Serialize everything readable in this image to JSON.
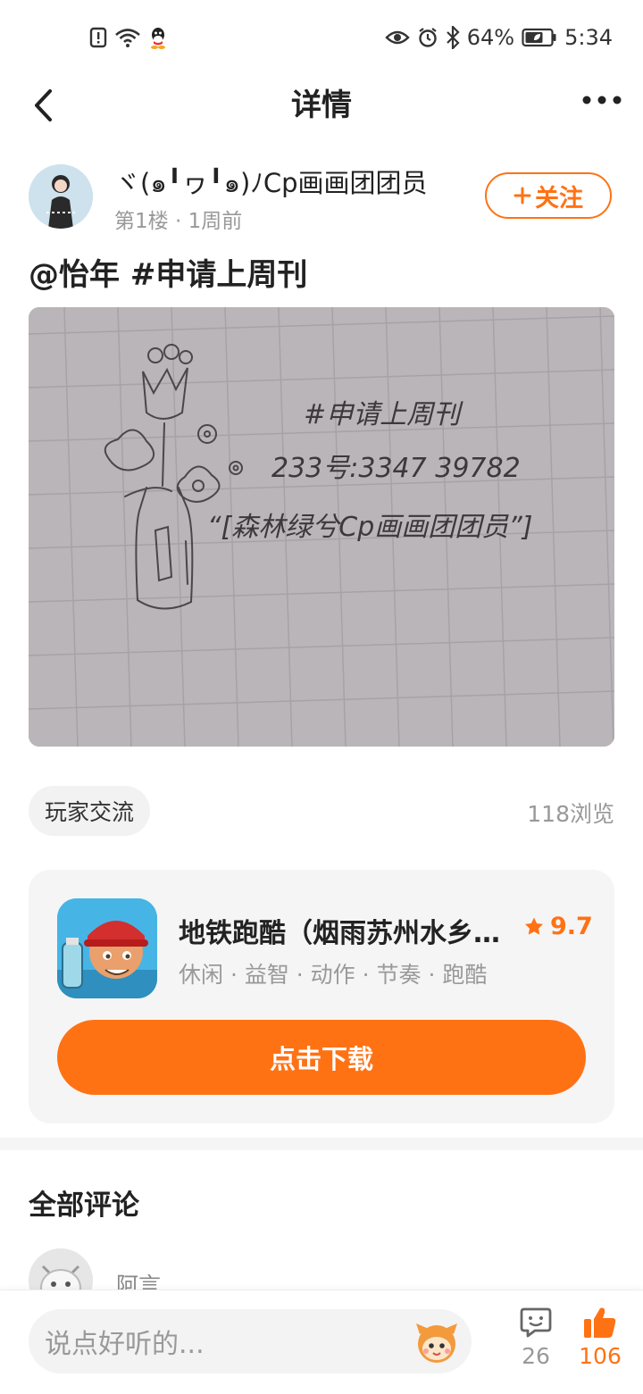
{
  "status_bar": {
    "battery": "64%",
    "time": "5:34",
    "icons": [
      "notification-icon",
      "wifi-icon",
      "qq-icon",
      "eye-icon",
      "alarm-icon",
      "bluetooth-icon",
      "battery-icon"
    ]
  },
  "header": {
    "title": "详情"
  },
  "author": {
    "name": "ヾ(๑╹ヮ╹๑)ﾉCp画画团团员",
    "meta": "第1楼 · 1周前",
    "follow_label": "关注"
  },
  "post": {
    "title": "@怡年   #申请上周刊",
    "tag": "玩家交流",
    "views": "118浏览"
  },
  "game_card": {
    "name": "地铁跑酷（烟雨苏州水乡…",
    "rating": "9.7",
    "tags": "休闲 · 益智 · 动作 · 节奏 · 跑酷",
    "download_label": "点击下载"
  },
  "comments": {
    "title": "全部评论",
    "first_commenter": "阿言"
  },
  "bottom_bar": {
    "input_placeholder": "说点好听的...",
    "comment_count": "26",
    "like_count": "106"
  },
  "colors": {
    "accent": "#ff7214",
    "text": "#222222",
    "muted": "#999999"
  }
}
